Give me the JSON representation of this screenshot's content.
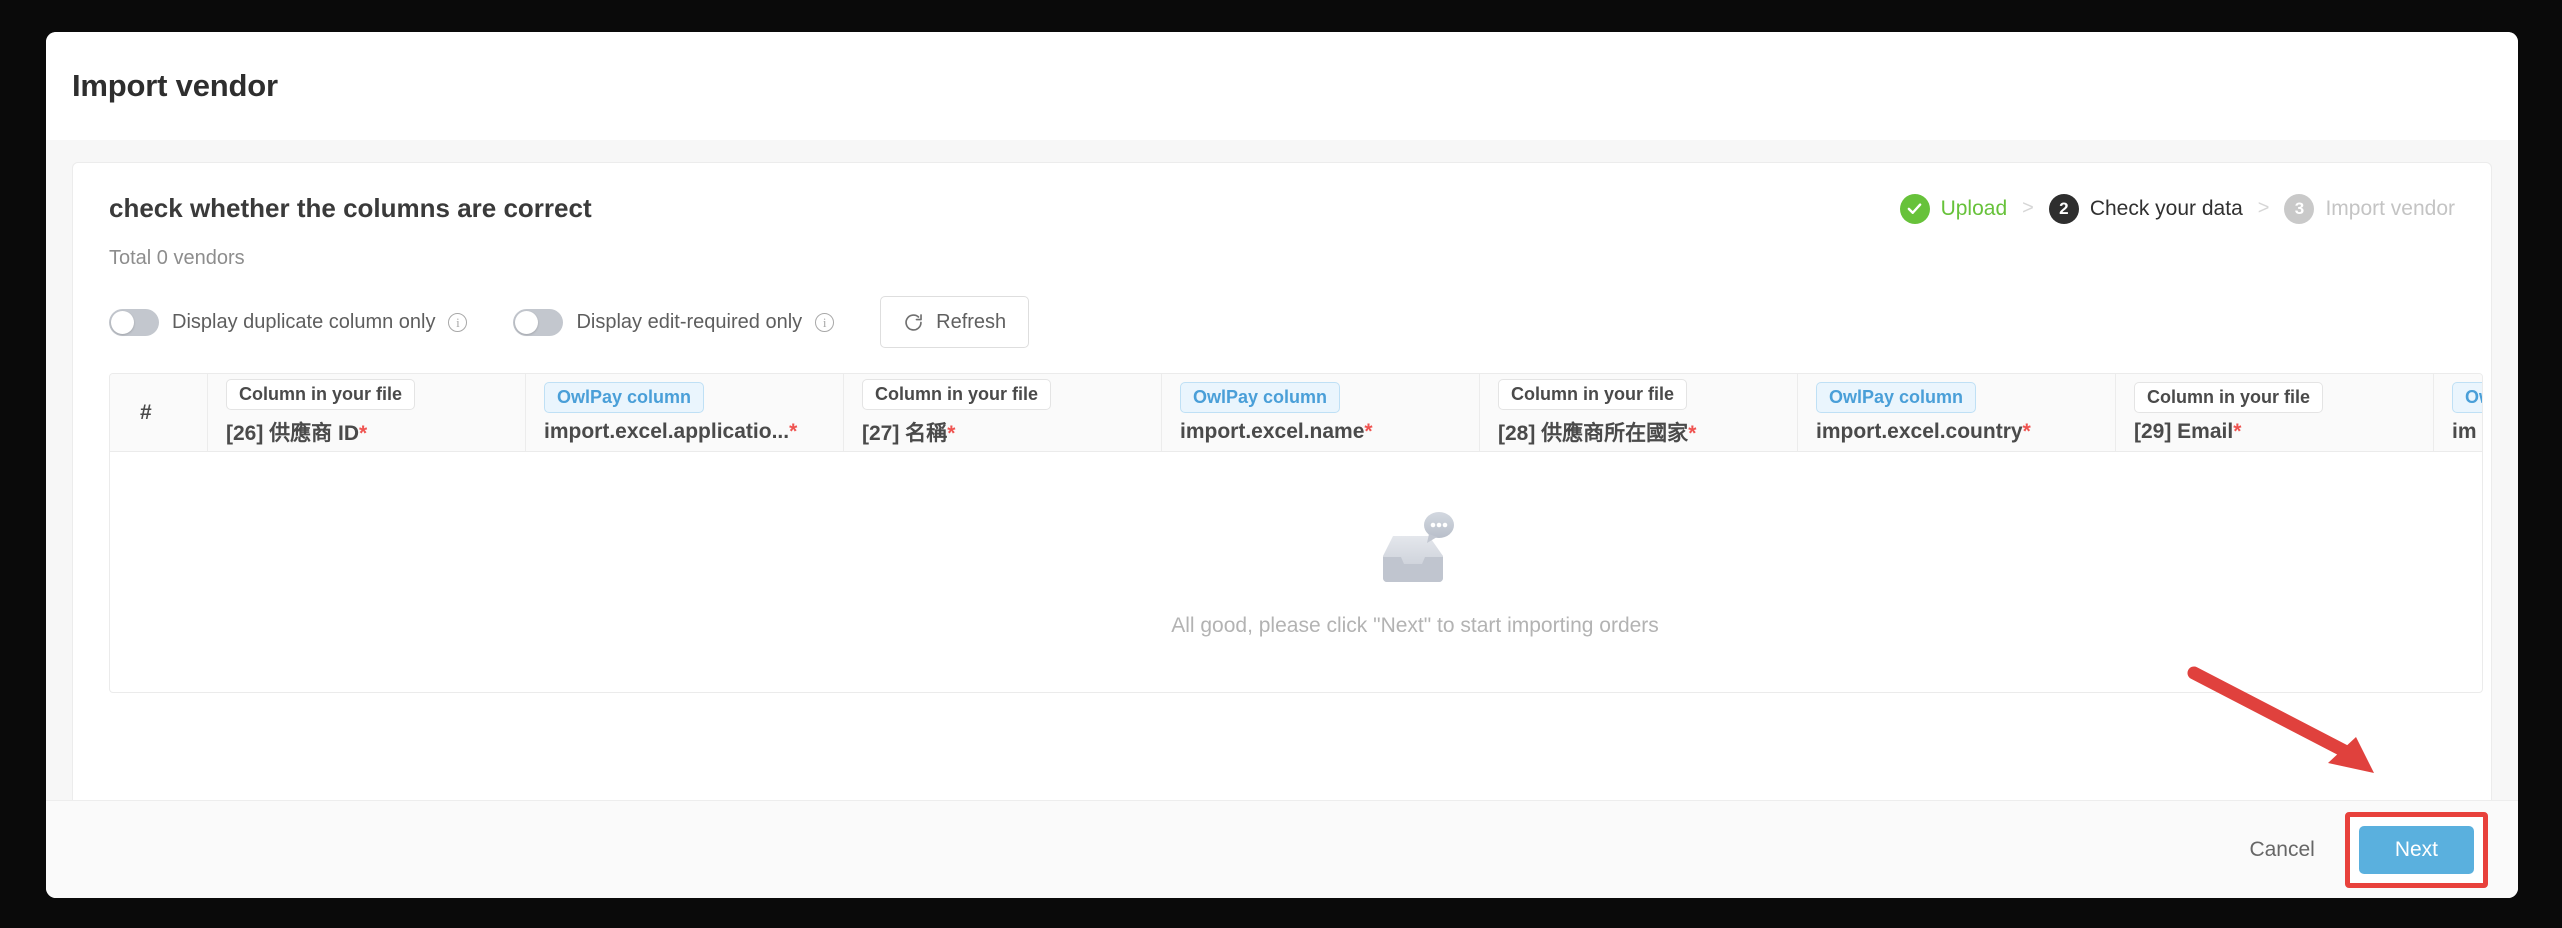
{
  "dialog": {
    "title": "Import vendor"
  },
  "panel": {
    "heading": "check whether the columns are correct",
    "total": "Total 0 vendors"
  },
  "steps": [
    {
      "badge": "check-icon",
      "label": "Upload",
      "state": "done"
    },
    {
      "badge": "2",
      "label": "Check your data",
      "state": "current"
    },
    {
      "badge": "3",
      "label": "Import vendor",
      "state": "pending"
    }
  ],
  "step_separator": ">",
  "controls": {
    "duplicate_toggle": {
      "label": "Display duplicate column only",
      "on": false
    },
    "edit_required_toggle": {
      "label": "Display edit-required only",
      "on": false
    },
    "refresh_label": "Refresh"
  },
  "table": {
    "index_header": "#",
    "badges": {
      "file": "Column in your file",
      "owlpay": "OwlPay column"
    },
    "columns": [
      {
        "badge_type": "file",
        "name": "[26] 供應商 ID",
        "required": true
      },
      {
        "badge_type": "owlpay",
        "name": "import.excel.applicatio...",
        "required": true
      },
      {
        "badge_type": "file",
        "name": "[27] 名稱",
        "required": true
      },
      {
        "badge_type": "owlpay",
        "name": "import.excel.name",
        "required": true
      },
      {
        "badge_type": "file",
        "name": "[28] 供應商所在國家",
        "required": true
      },
      {
        "badge_type": "owlpay",
        "name": "import.excel.country",
        "required": true
      },
      {
        "badge_type": "file",
        "name": "[29] Email",
        "required": true
      },
      {
        "badge_type": "owlpay",
        "name": "im",
        "required": false,
        "clipped": true
      }
    ],
    "empty_text": "All good, please click \"Next\" to start importing orders"
  },
  "footer": {
    "cancel_label": "Cancel",
    "next_label": "Next"
  },
  "colors": {
    "accent_blue": "#5ab0de",
    "badge_blue": "#4a9fd8",
    "success_green": "#67c23a",
    "required_red": "#ef5350",
    "annotation_red": "#e8413c",
    "pending_grey": "#c9c9c9"
  }
}
